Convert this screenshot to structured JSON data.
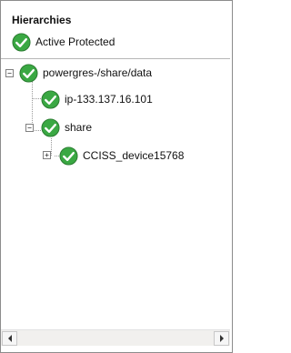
{
  "header": {
    "title": "Hierarchies",
    "status_label": "Active Protected",
    "status_icon": "check-circle-icon",
    "status_color": "#3aa843"
  },
  "tree": {
    "root": {
      "label": "powergres-/share/data",
      "expanded": true,
      "children": [
        {
          "label": "ip-133.137.16.101"
        },
        {
          "label": "share",
          "expanded": true,
          "children": [
            {
              "label": "CCISS_device15768",
              "expanded": false
            }
          ]
        }
      ]
    }
  },
  "toggle_symbols": {
    "expanded": "−",
    "collapsed": "+"
  },
  "scrollbar": {
    "orientation": "horizontal"
  }
}
